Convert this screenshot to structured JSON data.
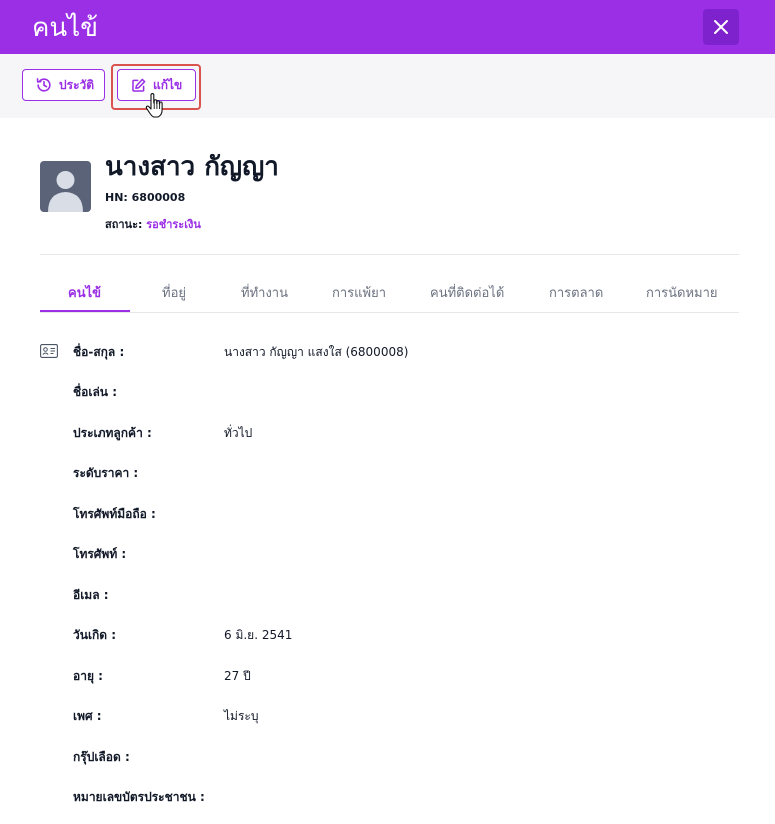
{
  "header": {
    "title": "คนไข้"
  },
  "toolbar": {
    "history_label": "ประวัติ",
    "edit_label": "แก้ไข"
  },
  "patient": {
    "name": "นางสาว กัญญา",
    "hn": "HN: 6800008",
    "status_label": "สถานะ:",
    "status_value": "รอชำระเงิน"
  },
  "tabs": [
    {
      "label": "คนไข้",
      "active": true
    },
    {
      "label": "ที่อยู่"
    },
    {
      "label": "ที่ทำงาน"
    },
    {
      "label": "การแพ้ยา"
    },
    {
      "label": "คนที่ติดต่อได้"
    },
    {
      "label": "การตลาด"
    },
    {
      "label": "การนัดหมาย"
    }
  ],
  "fields": [
    {
      "label": "ชื่อ-สกุล :",
      "value": "นางสาว กัญญา แสงใส (6800008)"
    },
    {
      "label": "ชื่อเล่น :",
      "value": ""
    },
    {
      "label": "ประเภทลูกค้า :",
      "value": "ทั่วไป"
    },
    {
      "label": "ระดับราคา :",
      "value": ""
    },
    {
      "label": "โทรศัพท์มือถือ :",
      "value": ""
    },
    {
      "label": "โทรศัพท์ :",
      "value": ""
    },
    {
      "label": "อีเมล :",
      "value": ""
    },
    {
      "label": "วันเกิด :",
      "value": "6 มิ.ย. 2541"
    },
    {
      "label": "อายุ :",
      "value": "27 ปี"
    },
    {
      "label": "เพศ :",
      "value": "ไม่ระบุ"
    },
    {
      "label": "กรุ๊ปเลือด :",
      "value": ""
    },
    {
      "label": "หมายเลขบัตรประชาชน :",
      "value": ""
    }
  ],
  "colors": {
    "accent": "#9b2fe6",
    "close_bg": "#7e22ce",
    "highlight": "#d9534f"
  },
  "icons": [
    "close-icon",
    "history-icon",
    "edit-icon",
    "avatar-icon",
    "id-card-icon",
    "hand-cursor-icon"
  ]
}
